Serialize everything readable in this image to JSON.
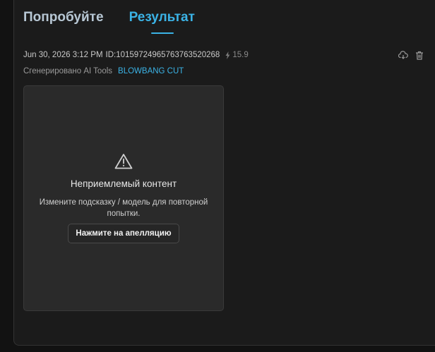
{
  "tabs": {
    "try_label": "Попробуйте",
    "result_label": "Результат"
  },
  "meta": {
    "datetime": "Jun 30, 2026 3:12 PM",
    "id": "ID:1015972496576376352026​8",
    "credits": "15.9"
  },
  "generated": {
    "label": "Сгенерировано AI Tools",
    "model": "BLOWBANG CUT"
  },
  "card": {
    "title": "Неприемлемый контент",
    "description": "Измените подсказку / модель для повторной попытки.",
    "appeal_label": "Нажмите на апелляцию"
  },
  "colors": {
    "accent": "#3bb3e6",
    "background": "#1b1b1b",
    "card": "#2a2a2a"
  }
}
